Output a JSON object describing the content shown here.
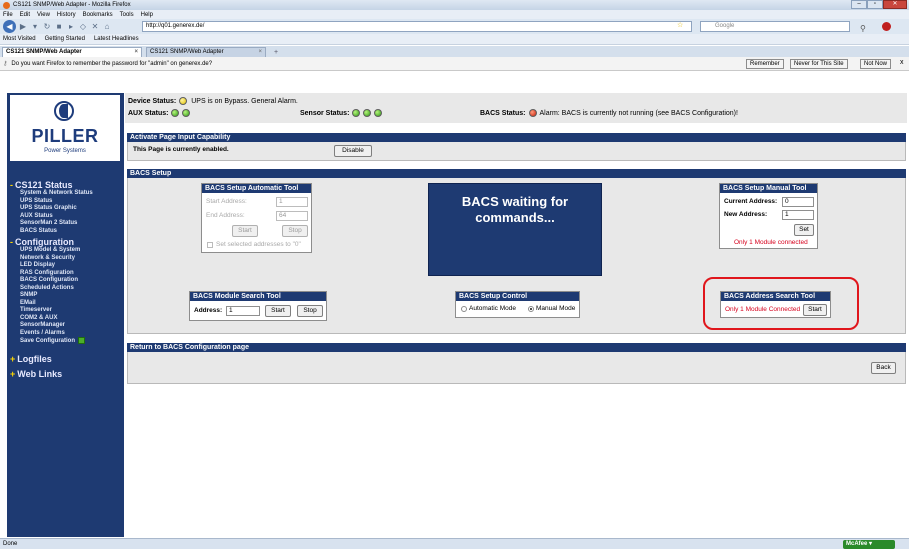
{
  "browser": {
    "window_title": "CS121 SNMP/Web Adapter - Mozilla Firefox",
    "menu": [
      "File",
      "Edit",
      "View",
      "History",
      "Bookmarks",
      "Tools",
      "Help"
    ],
    "url": "http://q01.generex.de/",
    "search_placeholder": "Google",
    "bookmarks": [
      "Most Visited",
      "Getting Started",
      "Latest Headlines"
    ],
    "tabs": [
      {
        "label": "CS121 SNMP/Web Adapter",
        "active": true
      },
      {
        "label": "CS121 SNMP/Web Adapter",
        "active": false
      }
    ],
    "password_bar": {
      "message": "Do you want Firefox to remember the password for \"admin\" on generex.de?",
      "remember": "Remember",
      "never": "Never for This Site",
      "not_now": "Not Now",
      "close": "x"
    },
    "status": "Done",
    "mcafee": "McAfee"
  },
  "logo": {
    "name": "PILLER",
    "tagline": "Power Systems"
  },
  "sidebar": {
    "cs121_status": {
      "heading": "CS121 Status",
      "items": [
        "System & Network Status",
        "UPS Status",
        "UPS Status Graphic",
        "AUX Status",
        "SensorMan 2 Status",
        "BACS Status"
      ]
    },
    "configuration": {
      "heading": "Configuration",
      "items": [
        "UPS Model & System",
        "Network & Security",
        "LED Display",
        "RAS Configuration",
        "BACS Configuration",
        "Scheduled Actions",
        "SNMP",
        "EMail",
        "Timeserver",
        "COM2 & AUX",
        "SensorManager",
        "Events / Alarms",
        "Save Configuration"
      ]
    },
    "logfiles": "Logfiles",
    "web_links": "Web Links"
  },
  "device_status": {
    "device_label": "Device Status:",
    "device_text": "UPS is on Bypass. General Alarm.",
    "aux_label": "AUX Status:",
    "sensor_label": "Sensor Status:",
    "bacs_label": "BACS Status:",
    "bacs_text": "Alarm: BACS is currently not running (see BACS Configuration)!",
    "colors": {
      "ok": "#2f9a14",
      "warning": "#e2c100",
      "alarm": "#c71d08"
    }
  },
  "page_input": {
    "heading": "Activate Page Input Capability",
    "message": "This Page is currently enabled.",
    "button": "Disable"
  },
  "bacs_setup": {
    "heading": "BACS Setup",
    "auto_tool": {
      "heading": "BACS Setup Automatic Tool",
      "start_label": "Start Address:",
      "start_value": "1",
      "end_label": "End Address:",
      "end_value": "64",
      "start_btn": "Start",
      "stop_btn": "Stop",
      "checkbox_label": "Set selected addresses to \"0\""
    },
    "waiting_message": "BACS waiting for commands...",
    "manual_tool": {
      "heading": "BACS Setup Manual Tool",
      "current_label": "Current Address:",
      "current_value": "0",
      "new_label": "New Address:",
      "new_value": "1",
      "set_btn": "Set",
      "connected_msg": "Only 1 Module connected"
    },
    "module_search": {
      "heading": "BACS Module Search Tool",
      "address_label": "Address:",
      "address_value": "1",
      "start_btn": "Start",
      "stop_btn": "Stop"
    },
    "control": {
      "heading": "BACS Setup Control",
      "auto_mode": "Automatic Mode",
      "manual_mode": "Manual Mode",
      "selected": "Manual Mode"
    },
    "address_search": {
      "heading": "BACS Address Search Tool",
      "message": "Only 1 Module Connected",
      "start_btn": "Start"
    }
  },
  "return_section": {
    "heading": "Return to BACS Configuration page",
    "back_btn": "Back"
  }
}
